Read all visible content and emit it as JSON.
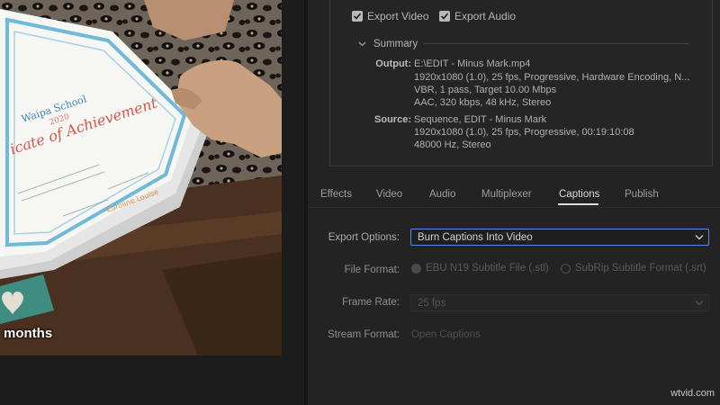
{
  "preview": {
    "caption_text": "months",
    "certificate_text": {
      "school": "Waipa School",
      "year": "2020",
      "title": "icate of Achievement"
    }
  },
  "export": {
    "export_video_label": "Export Video",
    "export_video_checked": true,
    "export_audio_label": "Export Audio",
    "export_audio_checked": true
  },
  "summary": {
    "heading": "Summary",
    "output_label": "Output:",
    "output_lines": [
      "E:\\EDIT - Minus Mark.mp4",
      "1920x1080 (1.0), 25 fps, Progressive, Hardware Encoding, N...",
      "VBR, 1 pass, Target 10.00 Mbps",
      "AAC, 320 kbps, 48 kHz, Stereo"
    ],
    "source_label": "Source:",
    "source_lines": [
      "Sequence, EDIT - Minus Mark",
      "1920x1080 (1.0), 25 fps, Progressive, 00:19:10:08",
      "48000 Hz, Stereo"
    ]
  },
  "tabs": [
    {
      "label": "Effects",
      "active": false
    },
    {
      "label": "Video",
      "active": false
    },
    {
      "label": "Audio",
      "active": false
    },
    {
      "label": "Multiplexer",
      "active": false
    },
    {
      "label": "Captions",
      "active": true
    },
    {
      "label": "Publish",
      "active": false
    }
  ],
  "captions": {
    "export_options_label": "Export Options:",
    "export_options_value": "Burn Captions Into Video",
    "file_format_label": "File Format:",
    "file_format_options": [
      {
        "label": "EBU N19 Subtitle File (.stl)",
        "selected": true
      },
      {
        "label": "SubRip Subtitle Format (.srt)",
        "selected": false
      }
    ],
    "frame_rate_label": "Frame Rate:",
    "frame_rate_value": "25 fps",
    "stream_format_label": "Stream Format:",
    "stream_format_value": "Open Captions"
  },
  "watermark": "wtvid.com",
  "colors": {
    "panel_bg": "#232323",
    "focus_border": "#5a8be0",
    "active_tab": "#dcdcdc"
  }
}
